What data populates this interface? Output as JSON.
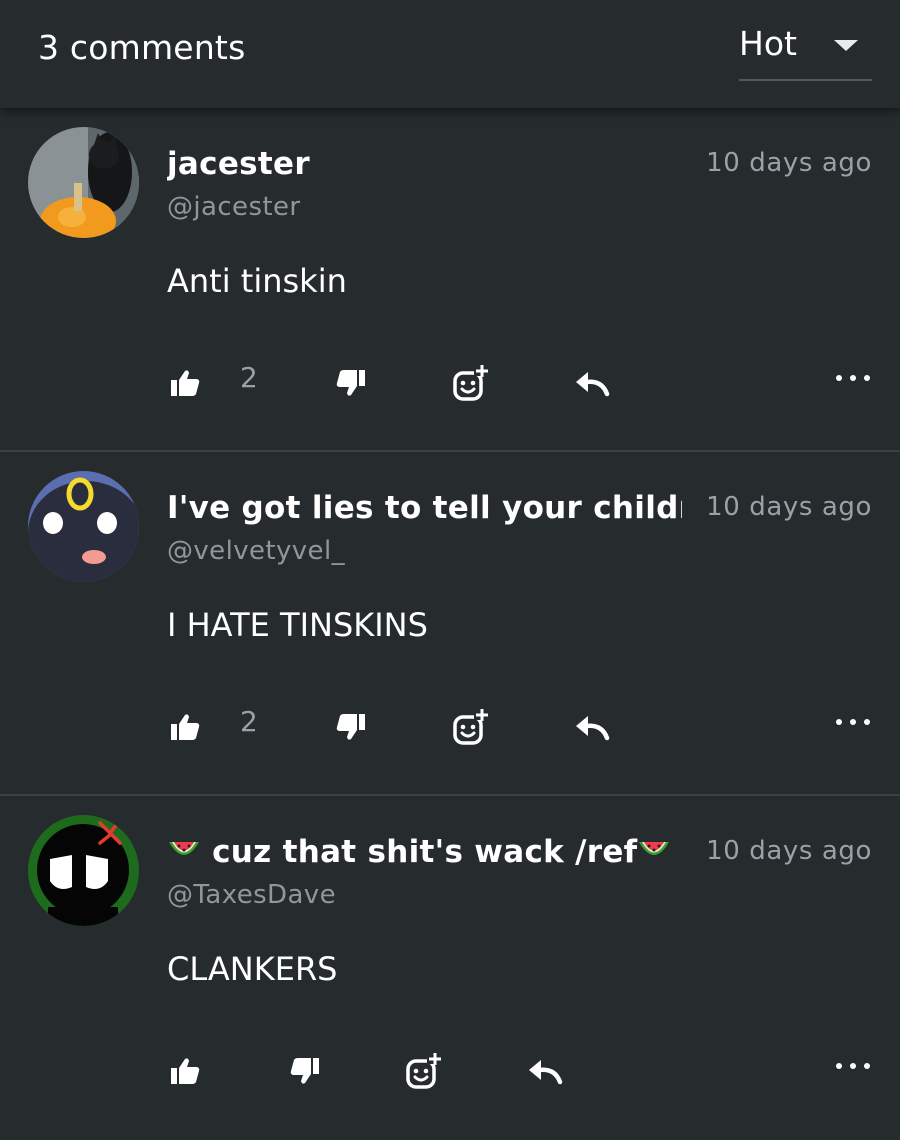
{
  "header": {
    "comment_count": "3 comments",
    "sort_label": "Hot"
  },
  "comments": [
    {
      "display_name": "jacester",
      "username": "@jacester",
      "timestamp": "10 days ago",
      "body": "Anti tinskin",
      "like_count": "2"
    },
    {
      "display_name": "I've got lies to tell your children",
      "username": "@velvetyvel_",
      "timestamp": "10 days ago",
      "body": "I HATE TINSKINS",
      "like_count": "2"
    },
    {
      "display_name_prefix": "🍉",
      "display_name": "cuz that shit's wack /ref",
      "display_name_suffix": "🍉",
      "display_name_tag": "#",
      "username": "@TaxesDave",
      "timestamp": "10 days ago",
      "body": "CLANKERS",
      "like_count": ""
    }
  ],
  "icons": {
    "like": "thumbs-up-icon",
    "dislike": "thumbs-down-icon",
    "react": "add-reaction-icon",
    "reply": "reply-icon",
    "more": "more-horizontal-icon"
  }
}
